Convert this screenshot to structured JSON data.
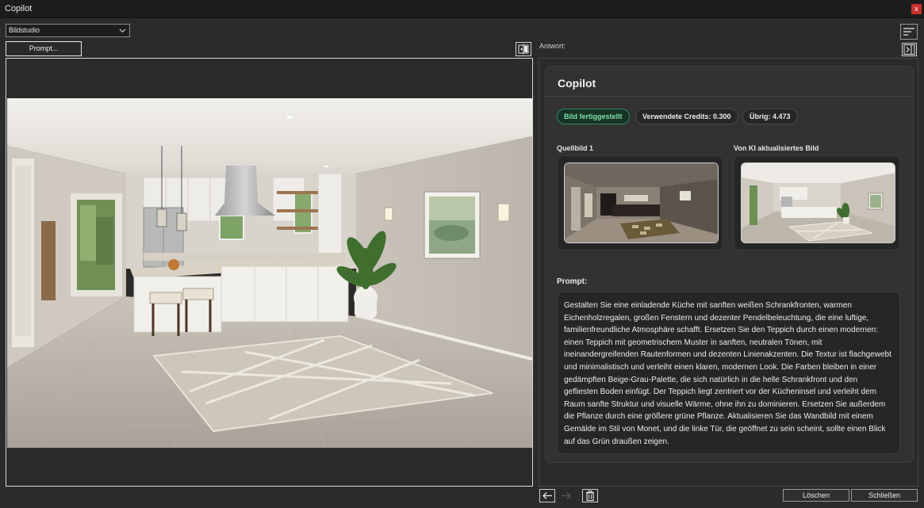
{
  "window": {
    "title": "Copilot",
    "close_glyph": "x"
  },
  "left": {
    "mode_select": {
      "value": "Bildstudio"
    },
    "prompt_button": "Prompt...",
    "compare_icon": "split-compare-icon"
  },
  "right": {
    "answer_label": "Antwort:",
    "card": {
      "title": "Copilot",
      "status_badge": "Bild fertiggestellt",
      "credits_badge": "Verwendete Credits: 0.300",
      "remaining_badge": "Übrig: 4.473",
      "source_label": "Quellbild 1",
      "updated_label": "Von KI aktualisiertes Bild",
      "prompt_label": "Prompt:",
      "prompt_text": "Gestalten Sie eine einladende Küche mit sanften weißen Schrankfronten, warmen Eichenholzregalen, großen Fenstern und dezenter Pendelbeleuchtung, die eine luftige, familienfreundliche Atmosphäre schafft. Ersetzen Sie den Teppich durch einen modernen: einen Teppich mit geometrischem Muster in sanften, neutralen Tönen, mit ineinandergreifenden Rautenformen und dezenten Linienakzenten. Die Textur ist flachgewebt und minimalistisch und verleiht einen klaren, modernen Look. Die Farben bleiben in einer gedämpften Beige-Grau-Palette, die sich natürlich in die helle Schrankfront und den gefliesten Boden einfügt. Der Teppich liegt zentriert vor der Kücheninsel und verleiht dem Raum sanfte Struktur und visuelle Wärme, ohne ihn zu dominieren. Ersetzen Sie außerdem die Pflanze durch eine größere grüne Pflanze. Aktualisieren Sie das Wandbild mit einem Gemälde im Stil von Monet, und die linke Tür, die geöffnet zu sein scheint, sollte einen Blick auf das Grün draußen zeigen."
    }
  },
  "bottom": {
    "delete_button": "Löschen",
    "close_button": "Schließen"
  },
  "colors": {
    "background": "#2b2b2b",
    "titlebar": "#1c1c1c",
    "close": "#c7322f",
    "status_green": "#7fe0aa",
    "card": "#323232"
  }
}
